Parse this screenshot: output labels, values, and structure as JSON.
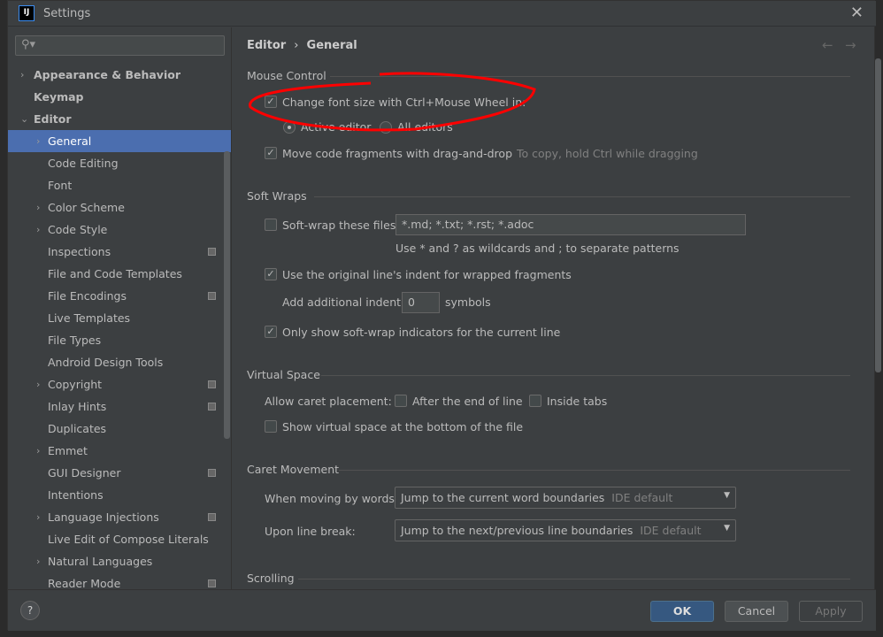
{
  "window": {
    "title": "Settings",
    "logo": "IJ",
    "close_icon": "close-icon"
  },
  "search": {
    "placeholder": "",
    "icon": "search-icon"
  },
  "sidebar": {
    "items": [
      {
        "label": "Appearance & Behavior",
        "arrow": "›",
        "level": 0
      },
      {
        "label": "Keymap",
        "arrow": "",
        "level": 0
      },
      {
        "label": "Editor",
        "arrow": "⌄",
        "level": 0
      },
      {
        "label": "General",
        "arrow": "›",
        "level": 1,
        "selected": true
      },
      {
        "label": "Code Editing",
        "arrow": "",
        "level": 1
      },
      {
        "label": "Font",
        "arrow": "",
        "level": 1
      },
      {
        "label": "Color Scheme",
        "arrow": "›",
        "level": 1
      },
      {
        "label": "Code Style",
        "arrow": "›",
        "level": 1
      },
      {
        "label": "Inspections",
        "arrow": "",
        "level": 1,
        "project": true
      },
      {
        "label": "File and Code Templates",
        "arrow": "",
        "level": 1
      },
      {
        "label": "File Encodings",
        "arrow": "",
        "level": 1,
        "project": true
      },
      {
        "label": "Live Templates",
        "arrow": "",
        "level": 1
      },
      {
        "label": "File Types",
        "arrow": "",
        "level": 1
      },
      {
        "label": "Android Design Tools",
        "arrow": "",
        "level": 1
      },
      {
        "label": "Copyright",
        "arrow": "›",
        "level": 1,
        "project": true
      },
      {
        "label": "Inlay Hints",
        "arrow": "",
        "level": 1,
        "project": true
      },
      {
        "label": "Duplicates",
        "arrow": "",
        "level": 1
      },
      {
        "label": "Emmet",
        "arrow": "›",
        "level": 1
      },
      {
        "label": "GUI Designer",
        "arrow": "",
        "level": 1,
        "project": true
      },
      {
        "label": "Intentions",
        "arrow": "",
        "level": 1
      },
      {
        "label": "Language Injections",
        "arrow": "›",
        "level": 1,
        "project": true
      },
      {
        "label": "Live Edit of Compose Literals",
        "arrow": "",
        "level": 1
      },
      {
        "label": "Natural Languages",
        "arrow": "›",
        "level": 1
      },
      {
        "label": "Reader Mode",
        "arrow": "",
        "level": 1,
        "project": true
      }
    ]
  },
  "breadcrumb": {
    "parent": "Editor",
    "sep": "›",
    "current": "General",
    "back": "←",
    "forward": "→"
  },
  "mouse": {
    "title": "Mouse Control",
    "ctrl_wheel": "Change font size with Ctrl+Mouse Wheel in:",
    "ctrl_wheel_checked": true,
    "active_editor": "Active editor",
    "all_editors": "All editors",
    "selected": "Active editor",
    "drag_drop": "Move code fragments with drag-and-drop",
    "drag_drop_checked": true,
    "drag_hint": "To copy, hold Ctrl while dragging"
  },
  "softwraps": {
    "title": "Soft Wraps",
    "softwrap_label": "Soft-wrap these files:",
    "softwrap_checked": false,
    "files": "*.md; *.txt; *.rst; *.adoc",
    "hint": "Use * and ? as wildcards and ; to separate patterns",
    "indent": "Use the original line's indent for wrapped fragments",
    "indent_checked": true,
    "add_indent": "Add additional indent:",
    "add_indent_value": "0",
    "symbols": "symbols",
    "only_current": "Only show soft-wrap indicators for the current line",
    "only_current_checked": true
  },
  "virtual": {
    "title": "Virtual Space",
    "allow_caret": "Allow caret placement:",
    "after_end": "After the end of line",
    "inside_tabs": "Inside tabs",
    "show_bottom": "Show virtual space at the bottom of the file"
  },
  "caret": {
    "title": "Caret Movement",
    "words_label": "When moving by words:",
    "words_value": "Jump to the current word boundaries",
    "words_hint": "IDE default",
    "break_label": "Upon line break:",
    "break_value": "Jump to the next/previous line boundaries",
    "break_hint": "IDE default"
  },
  "scrolling": {
    "title": "Scrolling"
  },
  "buttons": {
    "help": "?",
    "ok": "OK",
    "cancel": "Cancel",
    "apply": "Apply"
  },
  "colors": {
    "accent": "#4b6eaf",
    "annotation": "#ff0000"
  }
}
